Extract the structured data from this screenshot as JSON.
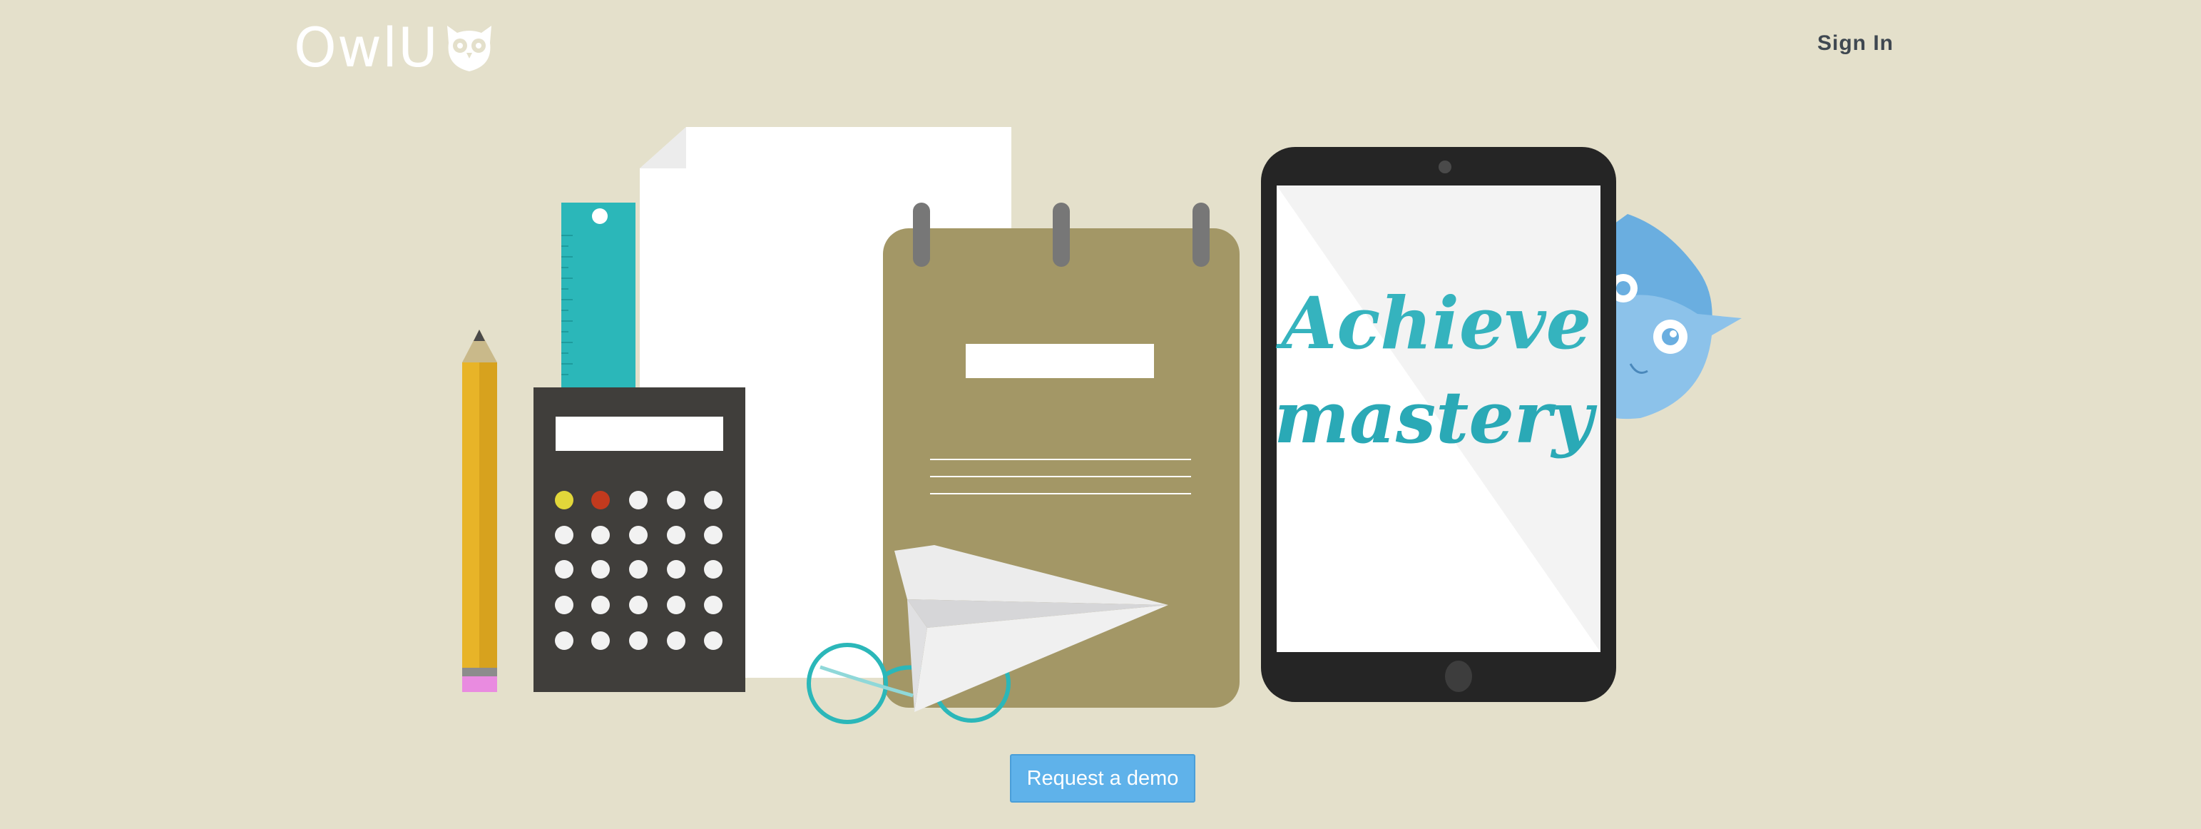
{
  "brand": {
    "name": "OwlU",
    "logo_icon": "owl-face-icon"
  },
  "nav": {
    "signin_label": "Sign In"
  },
  "hero": {
    "tablet_line1": "Achieve",
    "tablet_line2": "mastery",
    "colors": {
      "background": "#e4e0cb",
      "teal": "#2bb7b9",
      "notepad": "#a39766",
      "calculator": "#403e3b",
      "tablet": "#252525",
      "owl_blue": "#6aaee0"
    }
  },
  "cta": {
    "label": "Request a demo",
    "color": "#5fb2ea"
  }
}
